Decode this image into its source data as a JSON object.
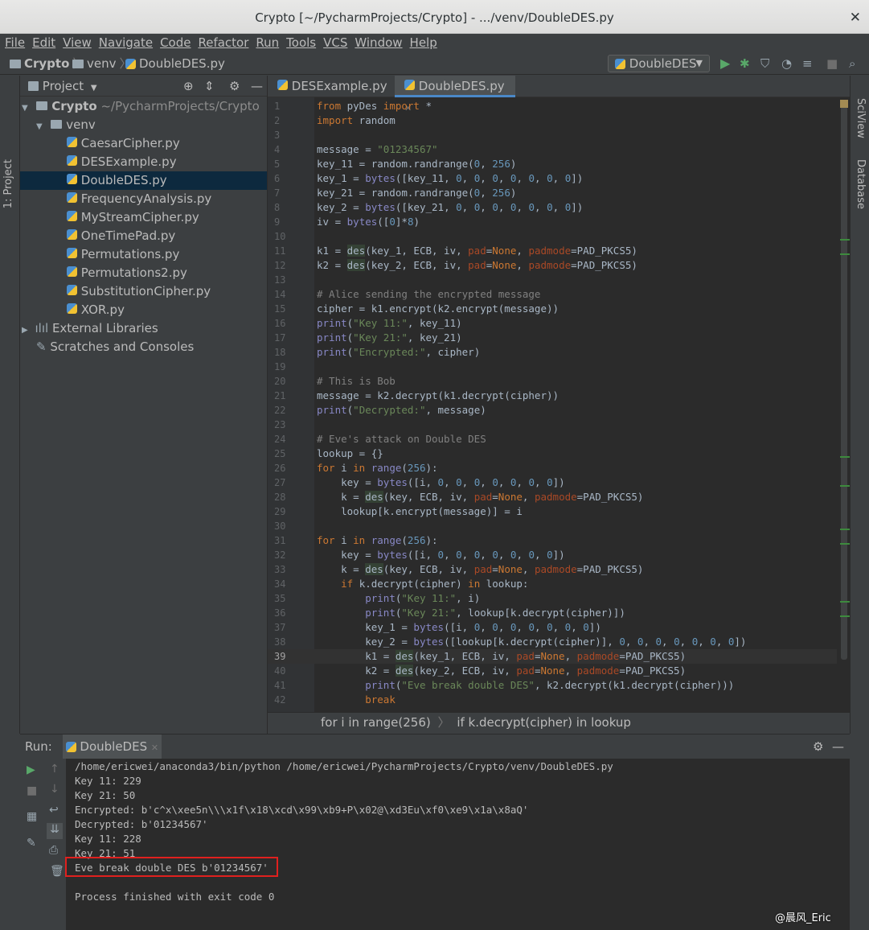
{
  "window": {
    "title": "Crypto [~/PycharmProjects/Crypto] - .../venv/DoubleDES.py",
    "close": "✕"
  },
  "menu": [
    "File",
    "Edit",
    "View",
    "Navigate",
    "Code",
    "Refactor",
    "Run",
    "Tools",
    "VCS",
    "Window",
    "Help"
  ],
  "breadcrumb": {
    "project": "Crypto",
    "folder": "venv",
    "file": "DoubleDES.py"
  },
  "run_config": {
    "label": "DoubleDES"
  },
  "left_strip": {
    "project_tab": "1: Project"
  },
  "right_strip": {
    "sciview": "SciView",
    "database": "Database"
  },
  "project_panel": {
    "title": "Project",
    "root": {
      "name": "Crypto",
      "path": "~/PycharmProjects/Crypto"
    },
    "folder": "venv",
    "files": [
      "CaesarCipher.py",
      "DESExample.py",
      "DoubleDES.py",
      "FrequencyAnalysis.py",
      "MyStreamCipher.py",
      "OneTimePad.py",
      "Permutations.py",
      "Permutations2.py",
      "SubstitutionCipher.py",
      "XOR.py"
    ],
    "external": "External Libraries",
    "scratches": "Scratches and Consoles"
  },
  "editor": {
    "tabs": [
      "DESExample.py",
      "DoubleDES.py"
    ],
    "breadcrumbs": [
      "for i in range(256)",
      "if k.decrypt(cipher) in lookup"
    ],
    "line_numbers": [
      "1",
      "2",
      "3",
      "4",
      "5",
      "6",
      "7",
      "8",
      "9",
      "10",
      "11",
      "12",
      "13",
      "14",
      "15",
      "16",
      "17",
      "18",
      "19",
      "20",
      "21",
      "22",
      "23",
      "24",
      "25",
      "26",
      "27",
      "28",
      "29",
      "30",
      "31",
      "32",
      "33",
      "34",
      "35",
      "36",
      "37",
      "38",
      "39",
      "40",
      "41",
      "42"
    ],
    "lines": [
      "from pyDes import *",
      "import random",
      "",
      "message = \"01234567\"",
      "key_11 = random.randrange(0, 256)",
      "key_1 = bytes([key_11, 0, 0, 0, 0, 0, 0, 0])",
      "key_21 = random.randrange(0, 256)",
      "key_2 = bytes([key_21, 0, 0, 0, 0, 0, 0, 0])",
      "iv = bytes([0]*8)",
      "",
      "k1 = des(key_1, ECB, iv, pad=None, padmode=PAD_PKCS5)",
      "k2 = des(key_2, ECB, iv, pad=None, padmode=PAD_PKCS5)",
      "",
      "# Alice sending the encrypted message",
      "cipher = k1.encrypt(k2.encrypt(message))",
      "print(\"Key 11:\", key_11)",
      "print(\"Key 21:\", key_21)",
      "print(\"Encrypted:\", cipher)",
      "",
      "# This is Bob",
      "message = k2.decrypt(k1.decrypt(cipher))",
      "print(\"Decrypted:\", message)",
      "",
      "# Eve's attack on Double DES",
      "lookup = {}",
      "for i in range(256):",
      "    key = bytes([i, 0, 0, 0, 0, 0, 0, 0])",
      "    k = des(key, ECB, iv, pad=None, padmode=PAD_PKCS5)",
      "    lookup[k.encrypt(message)] = i",
      "",
      "for i in range(256):",
      "    key = bytes([i, 0, 0, 0, 0, 0, 0, 0])",
      "    k = des(key, ECB, iv, pad=None, padmode=PAD_PKCS5)",
      "    if k.decrypt(cipher) in lookup:",
      "        print(\"Key 11:\", i)",
      "        print(\"Key 21:\", lookup[k.decrypt(cipher)])",
      "        key_1 = bytes([i, 0, 0, 0, 0, 0, 0, 0])",
      "        key_2 = bytes([lookup[k.decrypt(cipher)], 0, 0, 0, 0, 0, 0, 0])",
      "        k1 = des(key_1, ECB, iv, pad=None, padmode=PAD_PKCS5)",
      "        k2 = des(key_2, ECB, iv, pad=None, padmode=PAD_PKCS5)",
      "        print(\"Eve break double DES\", k2.decrypt(k1.decrypt(cipher)))",
      "        break"
    ]
  },
  "run_panel": {
    "label": "Run:",
    "tab": "DoubleDES",
    "output": [
      "/home/ericwei/anaconda3/bin/python /home/ericwei/PycharmProjects/Crypto/venv/DoubleDES.py",
      "Key 11: 229",
      "Key 21: 50",
      "Encrypted: b'c^x\\xee5n\\\\\\x1f\\x18\\xcd\\x99\\xb9+P\\x02@\\xd3Eu\\xf0\\xe9\\x1a\\x8aQ'",
      "Decrypted: b'01234567'",
      "Key 11: 228",
      "Key 21: 51",
      "Eve break double DES b'01234567'",
      "",
      "Process finished with exit code 0"
    ]
  },
  "watermark": "@晨风_Eric",
  "colors": {
    "highlight_box": "#e0201e",
    "selection": "#0d293e",
    "keyword": "#cc7832",
    "string": "#6a8759",
    "number": "#6897bb",
    "comment": "#808080"
  }
}
